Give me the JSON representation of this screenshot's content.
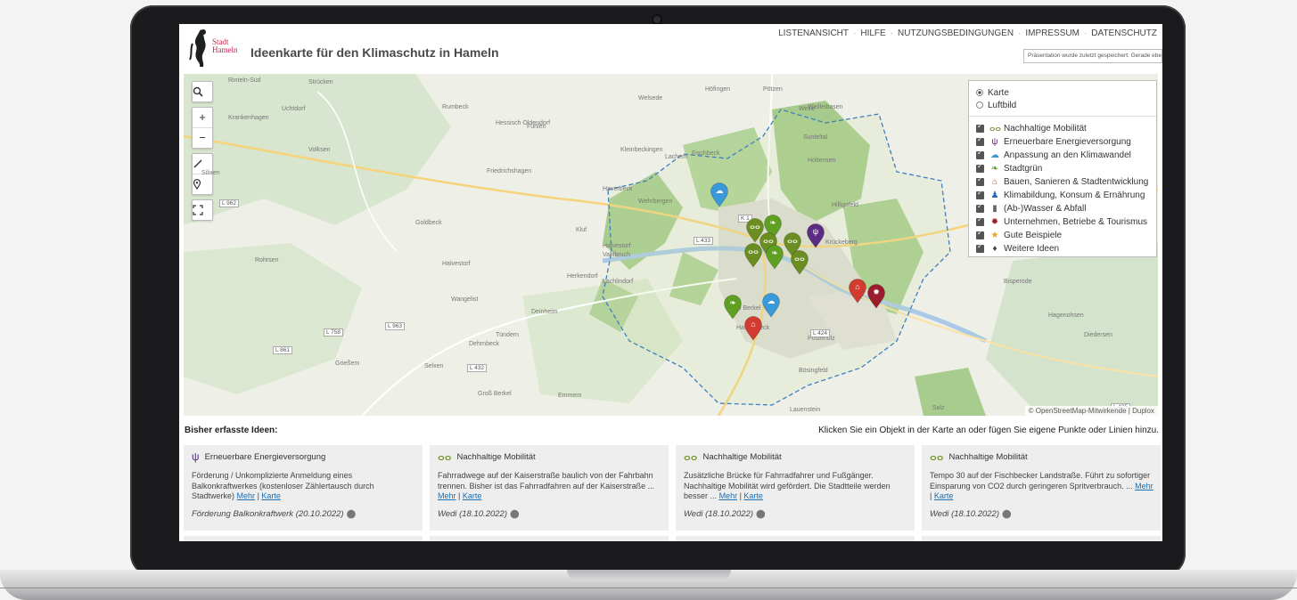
{
  "header": {
    "logo_line1": "Stadt",
    "logo_line2": "Hameln",
    "title": "Ideenkarte für den Klimaschutz in Hameln",
    "nav": [
      "LISTENANSICHT",
      "HILFE",
      "NUTZUNGSBEDINGUNGEN",
      "IMPRESSUM",
      "DATENSCHUTZ"
    ],
    "save_status": "Präsentation wurde zuletzt gespeichert: Gerade eben"
  },
  "map": {
    "controls": [
      "search-icon",
      "zoom-in-icon",
      "zoom-out-icon",
      "draw-line-icon",
      "place-marker-icon",
      "fullscreen-icon"
    ],
    "place_labels": [
      "Rinteln-Süd",
      "Strücken",
      "Krankenhagen",
      "Uchtdorf",
      "Volksen",
      "Rumbeck",
      "Hessisch Oldendorf",
      "Fuhlen",
      "Welsede",
      "Höfingen",
      "Pötzen",
      "Wellie",
      "Weilleibasen",
      "Fischbeck",
      "Kleinbeckingen",
      "Lachem",
      "Sunteltal",
      "Holtensen",
      "Haverbeck",
      "Wehrbergen",
      "Hilligsfeld",
      "Friedrichshagen",
      "Silixen",
      "Halvestorf",
      "Herkendorf",
      "Kluf",
      "Lachlindorf",
      "Rohrsen",
      "Krückeberg",
      "Goldbeck",
      "Halvestorf",
      "Vahlbruch",
      "Wangelist",
      "Klein Berkel",
      "Hastenbeck",
      "Posteholz",
      "Dehrnbeck",
      "Deinheim",
      "Tündern",
      "Bösingfeld",
      "Grießem",
      "Selxen",
      "Groß Berkel",
      "Emmern",
      "Lauenstein",
      "Diedersen",
      "Bisperode",
      "Hagenohsen",
      "Salz"
    ],
    "road_labels": [
      "K 1",
      "L 433",
      "L 424",
      "L 432",
      "L 758",
      "L 962",
      "L 963",
      "L 861",
      "L 425"
    ],
    "base_layers": [
      {
        "label": "Karte",
        "selected": true
      },
      {
        "label": "Luftbild",
        "selected": false
      }
    ],
    "overlays": [
      {
        "label": "Nachhaltige Mobilität",
        "icon": "bicycle-icon",
        "color": "#6b8e23",
        "checked": true
      },
      {
        "label": "Erneuerbare Energieversorgung",
        "icon": "plug-icon",
        "color": "#5b2c83",
        "checked": true
      },
      {
        "label": "Anpassung an den Klimawandel",
        "icon": "cloud-icon",
        "color": "#3a9ad9",
        "checked": true
      },
      {
        "label": "Stadtgrün",
        "icon": "leaf-icon",
        "color": "#5fa022",
        "checked": true
      },
      {
        "label": "Bauen, Sanieren & Stadtentwicklung",
        "icon": "house-icon",
        "color": "#d23b2f",
        "checked": true
      },
      {
        "label": "Klimabildung, Konsum & Ernährung",
        "icon": "people-icon",
        "color": "#2a6cb3",
        "checked": true
      },
      {
        "label": "(Ab-)Wasser & Abfall",
        "icon": "trash-icon",
        "color": "#666666",
        "checked": true
      },
      {
        "label": "Unternehmen, Betriebe & Tourismus",
        "icon": "gear-icon",
        "color": "#9b1c2c",
        "checked": true
      },
      {
        "label": "Gute Beispiele",
        "icon": "star-icon",
        "color": "#f0a020",
        "checked": true
      },
      {
        "label": "Weitere Ideen",
        "icon": "lightbulb-icon",
        "color": "#444444",
        "checked": true
      }
    ],
    "attribution": "© OpenStreetMap-Mitwirkende | Duplox"
  },
  "ideas": {
    "heading": "Bisher erfasste Ideen:",
    "hint": "Klicken Sie ein Objekt in der Karte an oder fügen Sie eigene Punkte oder Linien hinzu.",
    "cards": [
      {
        "category": "Erneuerbare Energieversorgung",
        "icon": "plug-icon",
        "color": "#5b2c83",
        "text": "Förderung / Unkomplizierte Anmeldung eines Balkonkraftwerkes (kostenloser Zählertausch durch Stadtwerke)",
        "ellipsis": "",
        "more": "Mehr",
        "map": "Karte",
        "footer": "Förderung Balkonkraftwerk (20.10.2022)"
      },
      {
        "category": "Nachhaltige Mobilität",
        "icon": "bicycle-icon",
        "color": "#6b8e23",
        "text": "Fahrradwege auf der Kaiserstraße baulich von der Fahrbahn trennen. Bisher ist das Fahrradfahren auf der Kaiserstraße",
        "ellipsis": "...",
        "more": "Mehr",
        "map": "Karte",
        "footer": "Wedi (18.10.2022)"
      },
      {
        "category": "Nachhaltige Mobilität",
        "icon": "bicycle-icon",
        "color": "#6b8e23",
        "text": "Zusätzliche Brücke für Fahrradfahrer und Fußgänger. Nachhaltige Mobilität wird gefördert. Die Stadtteile werden besser",
        "ellipsis": "...",
        "more": "Mehr",
        "map": "Karte",
        "footer": "Wedi (18.10.2022)"
      },
      {
        "category": "Nachhaltige Mobilität",
        "icon": "bicycle-icon",
        "color": "#6b8e23",
        "text": "Tempo 30 auf der Fischbecker Landstraße. Führt zu sofortiger Einsparung von CO2 durch geringeren Spritverbrauch.",
        "ellipsis": "...",
        "more": "Mehr",
        "map": "Karte",
        "footer": "Wedi (18.10.2022)"
      }
    ]
  },
  "markers": [
    {
      "type": "cloud-icon",
      "color": "#3a9ad9"
    },
    {
      "type": "bicycle-icon",
      "color": "#6b8e23"
    },
    {
      "type": "leaf-icon",
      "color": "#5fa022"
    },
    {
      "type": "bicycle-icon",
      "color": "#6b8e23"
    },
    {
      "type": "bicycle-icon",
      "color": "#6b8e23"
    },
    {
      "type": "leaf-icon",
      "color": "#5fa022"
    },
    {
      "type": "plug-icon",
      "color": "#5b2c83"
    },
    {
      "type": "bicycle-icon",
      "color": "#6b8e23"
    },
    {
      "type": "bicycle-icon",
      "color": "#6b8e23"
    },
    {
      "type": "house-icon",
      "color": "#d23b2f"
    },
    {
      "type": "gear-icon",
      "color": "#9b1c2c"
    },
    {
      "type": "leaf-icon",
      "color": "#5fa022"
    },
    {
      "type": "cloud-icon",
      "color": "#3a9ad9"
    },
    {
      "type": "house-icon",
      "color": "#d23b2f"
    }
  ]
}
